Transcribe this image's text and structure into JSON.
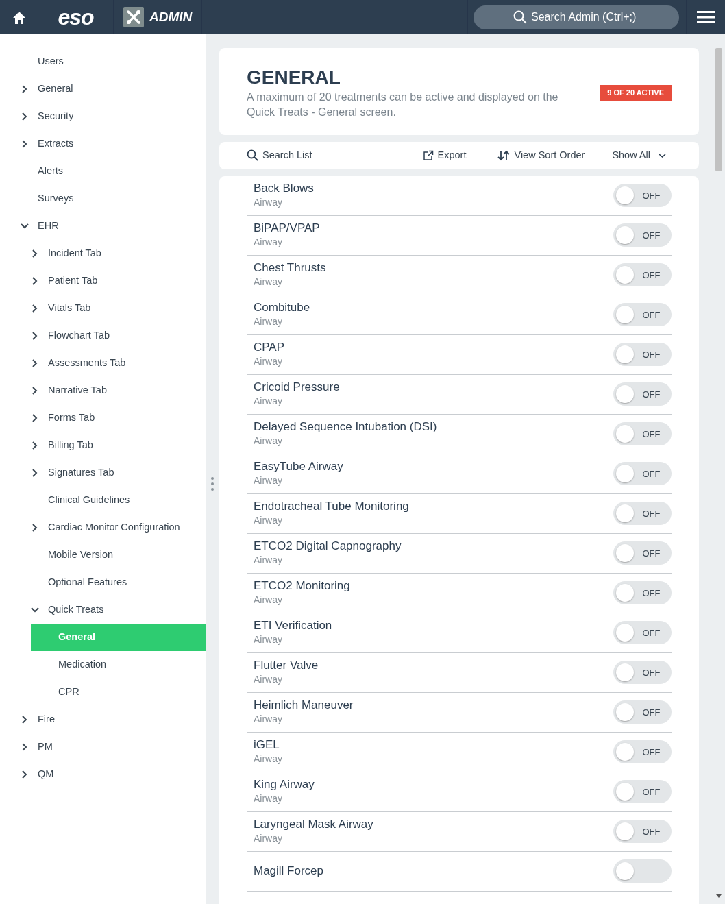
{
  "topbar": {
    "logo": "eso",
    "app_title": "ADMIN",
    "search": {
      "placeholder": "Search Admin (Ctrl+;)"
    }
  },
  "sidebar": {
    "items": [
      {
        "label": "Users",
        "selected": false
      },
      {
        "label": "General",
        "selected": false,
        "expanded": false
      },
      {
        "label": "Security",
        "selected": false,
        "expanded": false
      },
      {
        "label": "Extracts",
        "selected": false,
        "expanded": false
      },
      {
        "label": "Alerts",
        "selected": false
      },
      {
        "label": "Surveys",
        "selected": false
      },
      {
        "label": "EHR",
        "selected": false,
        "expanded": true,
        "children": [
          {
            "label": "Incident Tab",
            "selected": false,
            "expanded": false
          },
          {
            "label": "Patient Tab",
            "selected": false,
            "expanded": false
          },
          {
            "label": "Vitals Tab",
            "selected": false,
            "expanded": false
          },
          {
            "label": "Flowchart Tab",
            "selected": false,
            "expanded": false
          },
          {
            "label": "Assessments Tab",
            "selected": false,
            "expanded": false
          },
          {
            "label": "Narrative Tab",
            "selected": false,
            "expanded": false
          },
          {
            "label": "Forms Tab",
            "selected": false,
            "expanded": false
          },
          {
            "label": "Billing Tab",
            "selected": false,
            "expanded": false
          },
          {
            "label": "Signatures Tab",
            "selected": false,
            "expanded": false
          },
          {
            "label": "Clinical Guidelines",
            "selected": false
          },
          {
            "label": "Cardiac Monitor Configuration",
            "selected": false,
            "expanded": false
          },
          {
            "label": "Mobile Version",
            "selected": false
          },
          {
            "label": "Optional Features",
            "selected": false
          },
          {
            "label": "Quick Treats",
            "selected": false,
            "expanded": true,
            "children": [
              {
                "label": "General",
                "selected": true
              },
              {
                "label": "Medication",
                "selected": false
              },
              {
                "label": "CPR",
                "selected": false
              }
            ]
          }
        ]
      },
      {
        "label": "Fire",
        "selected": false,
        "expanded": false
      },
      {
        "label": "PM",
        "selected": false,
        "expanded": false
      },
      {
        "label": "QM",
        "selected": false,
        "expanded": false
      }
    ]
  },
  "header": {
    "title": "GENERAL",
    "description": "A maximum of 20 treatments can be active and displayed on the Quick Treats - General screen.",
    "badge": "9 OF 20 ACTIVE"
  },
  "toolbar": {
    "search": "Search List",
    "export": "Export",
    "sort": "View Sort Order",
    "filter": "Show All"
  },
  "treatments": [
    {
      "name": "Back Blows",
      "category": "Airway",
      "on": false,
      "state_label": "OFF"
    },
    {
      "name": "BiPAP/VPAP",
      "category": "Airway",
      "on": false,
      "state_label": "OFF"
    },
    {
      "name": "Chest Thrusts",
      "category": "Airway",
      "on": false,
      "state_label": "OFF"
    },
    {
      "name": "Combitube",
      "category": "Airway",
      "on": false,
      "state_label": "OFF"
    },
    {
      "name": "CPAP",
      "category": "Airway",
      "on": false,
      "state_label": "OFF"
    },
    {
      "name": "Cricoid Pressure",
      "category": "Airway",
      "on": false,
      "state_label": "OFF"
    },
    {
      "name": "Delayed Sequence Intubation (DSI)",
      "category": "Airway",
      "on": false,
      "state_label": "OFF"
    },
    {
      "name": "EasyTube Airway",
      "category": "Airway",
      "on": false,
      "state_label": "OFF"
    },
    {
      "name": "Endotracheal Tube Monitoring",
      "category": "Airway",
      "on": false,
      "state_label": "OFF"
    },
    {
      "name": "ETCO2 Digital Capnography",
      "category": "Airway",
      "on": false,
      "state_label": "OFF"
    },
    {
      "name": "ETCO2 Monitoring",
      "category": "Airway",
      "on": false,
      "state_label": "OFF"
    },
    {
      "name": "ETI Verification",
      "category": "Airway",
      "on": false,
      "state_label": "OFF"
    },
    {
      "name": "Flutter Valve",
      "category": "Airway",
      "on": false,
      "state_label": "OFF"
    },
    {
      "name": "Heimlich Maneuver",
      "category": "Airway",
      "on": false,
      "state_label": "OFF"
    },
    {
      "name": "iGEL",
      "category": "Airway",
      "on": false,
      "state_label": "OFF"
    },
    {
      "name": "King Airway",
      "category": "Airway",
      "on": false,
      "state_label": "OFF"
    },
    {
      "name": "Laryngeal Mask Airway",
      "category": "Airway",
      "on": false,
      "state_label": "OFF"
    },
    {
      "name": "Magill Forcep",
      "on": false
    }
  ]
}
